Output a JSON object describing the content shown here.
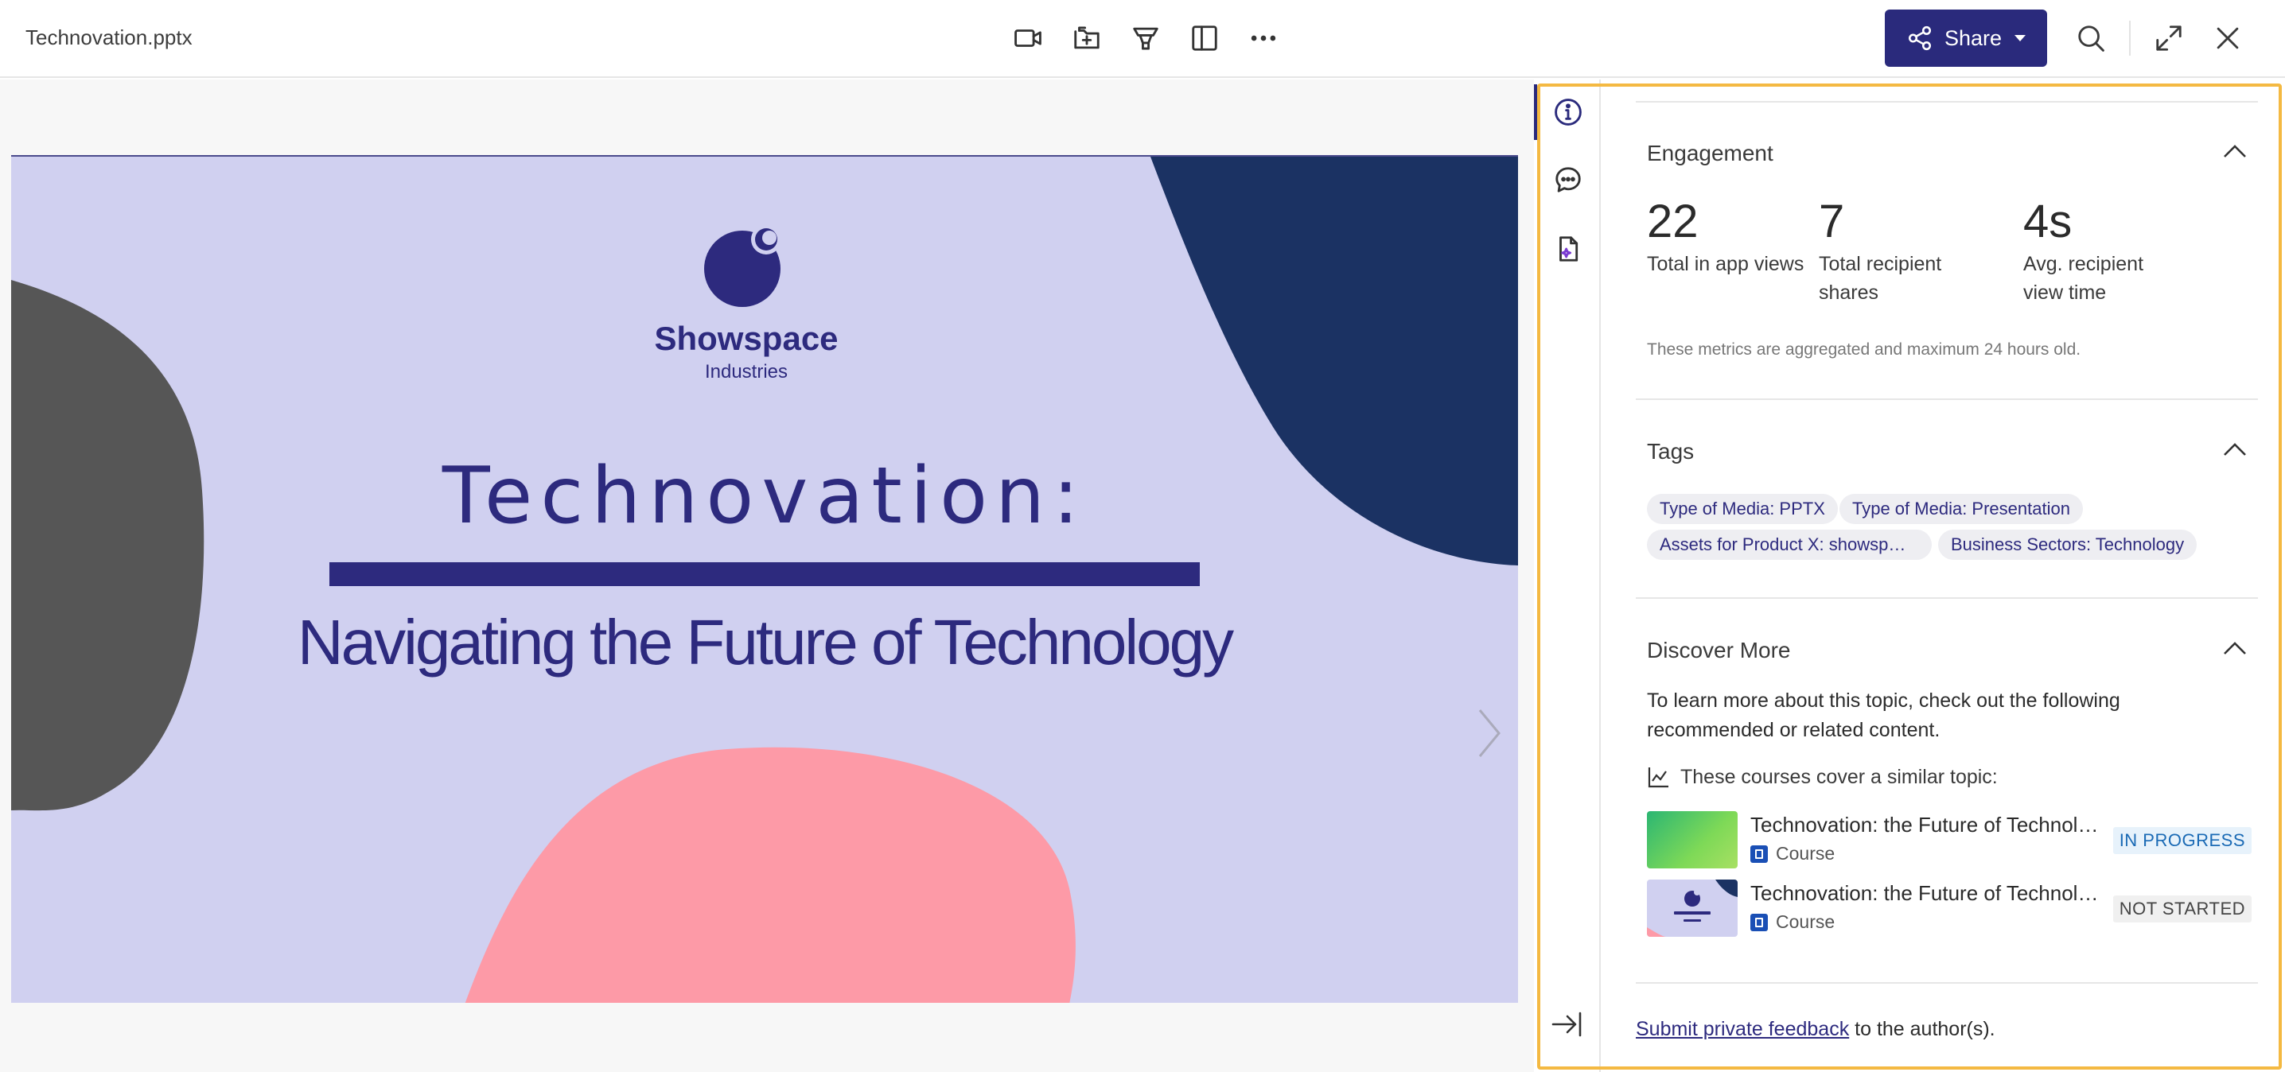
{
  "header": {
    "filename": "Technovation.pptx",
    "share_label": "Share"
  },
  "toolbar_icons": [
    "video-icon",
    "add-to-folder-icon",
    "funnel-icon",
    "split-view-icon",
    "more-icon"
  ],
  "slide": {
    "logo_name": "Showspace",
    "logo_sub": "Industries",
    "title": "Technovation:",
    "subtitle": "Navigating the Future of Technology"
  },
  "colors": {
    "accent": "#2a2a7c",
    "slide_bg": "#d0d0f0",
    "slide_text": "#2d2a7e",
    "slide_dark_blob": "#1b3263",
    "slide_gray_blob": "#565656",
    "slide_pink_blob": "#fd9aa7",
    "highlight_border": "#f4b942"
  },
  "panel": {
    "engagement": {
      "title": "Engagement",
      "metrics": [
        {
          "value": "22",
          "label": "Total in app views"
        },
        {
          "value": "7",
          "label": "Total recipient shares"
        },
        {
          "value": "4s",
          "label": "Avg. recipient view time"
        }
      ],
      "note": "These metrics are aggregated and maximum 24 hours old."
    },
    "tags": {
      "title": "Tags",
      "items": [
        "Type of Media: PPTX",
        "Type of Media: Presentation",
        "Assets for Product X: showsp…",
        "Business Sectors: Technology"
      ]
    },
    "discover": {
      "title": "Discover More",
      "text": "To learn more about this topic, check out the following recommended or related content.",
      "similar_label": "These courses cover a similar topic:",
      "courses": [
        {
          "title": "Technovation: the Future of Technol…",
          "type": "Course",
          "status": "IN PROGRESS"
        },
        {
          "title": "Technovation: the Future of Technol…",
          "type": "Course",
          "status": "NOT STARTED"
        }
      ]
    },
    "feedback": {
      "link": "Submit private feedback",
      "suffix": " to the author(s)."
    }
  }
}
